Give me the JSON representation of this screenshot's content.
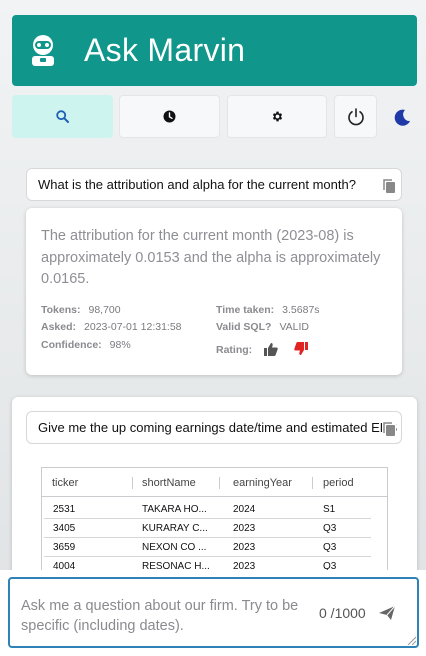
{
  "header": {
    "title": "Ask Marvin"
  },
  "toolbar": {
    "buttons": [
      "search-icon",
      "history-icon",
      "settings-icon",
      "power-icon"
    ],
    "theme_toggle": "moon-icon"
  },
  "conversation": [
    {
      "question": "What is the attribution and alpha for the current month?",
      "answer": "The attribution for the current month (2023-08) is approximately 0.0153 and the alpha is approximately 0.0165.",
      "meta": {
        "tokens_label": "Tokens:",
        "tokens": "98,700",
        "time_label": "Time taken:",
        "time": "3.5687s",
        "asked_label": "Asked:",
        "asked": "2023-07-01 12:31:58",
        "sql_label": "Valid SQL?",
        "sql": "VALID",
        "confidence_label": "Confidence:",
        "confidence": "98%",
        "rating_label": "Rating:"
      }
    },
    {
      "question": "Give me the up coming earnings date/time and estimated EPS",
      "table": {
        "columns": [
          "ticker",
          "shortName",
          "earningYear",
          "period"
        ],
        "rows": [
          [
            "2531",
            "TAKARA HO...",
            "2024",
            "S1"
          ],
          [
            "3405",
            "KURARAY C...",
            "2023",
            "Q3"
          ],
          [
            "3659",
            "NEXON CO ...",
            "2023",
            "Q3"
          ],
          [
            "4004",
            "RESONAC H...",
            "2023",
            "Q3"
          ]
        ]
      }
    }
  ],
  "input": {
    "placeholder": "Ask me a question about our firm. Try to be specific (including dates).",
    "counter": "0 /1000"
  },
  "colors": {
    "brand": "#10968a",
    "active_tab": "#cdf4ef",
    "input_border": "#2f82b5",
    "thumb_down": "#e02424"
  }
}
